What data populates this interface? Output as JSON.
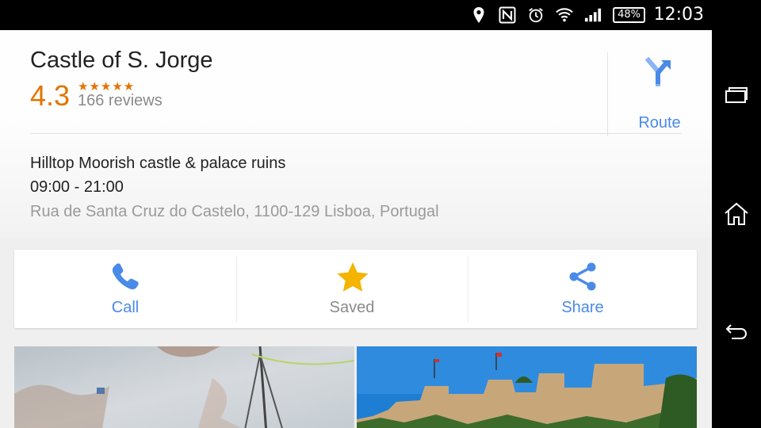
{
  "status_bar": {
    "battery": "48%",
    "time": "12:03",
    "icons": [
      "location-icon",
      "nfc-icon",
      "alarm-icon",
      "wifi-icon",
      "signal-icon",
      "battery-icon"
    ]
  },
  "place": {
    "title": "Castle of S. Jorge",
    "rating": "4.3",
    "stars": "★★★★★",
    "rating_value": 4.3,
    "reviews": "166 reviews",
    "description": "Hilltop Moorish castle & palace ruins",
    "hours": "09:00 - 21:00",
    "address": "Rua de Santa Cruz do Castelo, 1100-129 Lisboa, Portugal"
  },
  "route": {
    "label": "Route"
  },
  "actions": {
    "call": "Call",
    "saved": "Saved",
    "share": "Share"
  },
  "colors": {
    "accent": "#4a8ae8",
    "rating": "#e37400",
    "star_saved": "#f4b400"
  },
  "nav": [
    "recent-apps-icon",
    "home-icon",
    "back-icon"
  ]
}
